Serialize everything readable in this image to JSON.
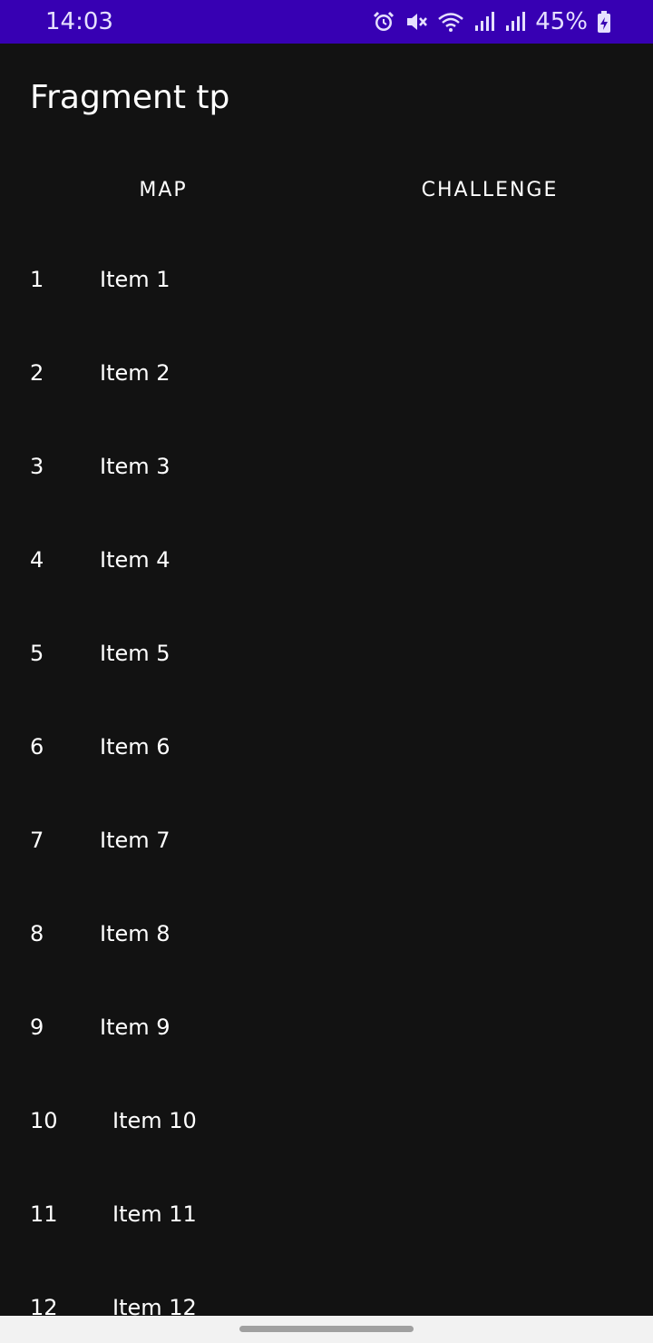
{
  "status_bar": {
    "time": "14:03",
    "battery": "45%",
    "icons": [
      "alarm-icon",
      "vibrate-mute-icon",
      "wifi-icon",
      "signal-icon",
      "signal-icon",
      "battery-charging-icon"
    ],
    "color": "#3700b3"
  },
  "app_bar": {
    "title": "Fragment tp"
  },
  "tabs": [
    {
      "label": "MAP"
    },
    {
      "label": "CHALLENGE"
    }
  ],
  "list": {
    "items": [
      {
        "number": "1",
        "content": "Item 1"
      },
      {
        "number": "2",
        "content": "Item 2"
      },
      {
        "number": "3",
        "content": "Item 3"
      },
      {
        "number": "4",
        "content": "Item 4"
      },
      {
        "number": "5",
        "content": "Item 5"
      },
      {
        "number": "6",
        "content": "Item 6"
      },
      {
        "number": "7",
        "content": "Item 7"
      },
      {
        "number": "8",
        "content": "Item 8"
      },
      {
        "number": "9",
        "content": "Item 9"
      },
      {
        "number": "10",
        "content": "Item 10"
      },
      {
        "number": "11",
        "content": "Item 11"
      },
      {
        "number": "12",
        "content": "Item 12"
      }
    ]
  },
  "theme": {
    "background": "#121212",
    "text": "#ffffff"
  }
}
